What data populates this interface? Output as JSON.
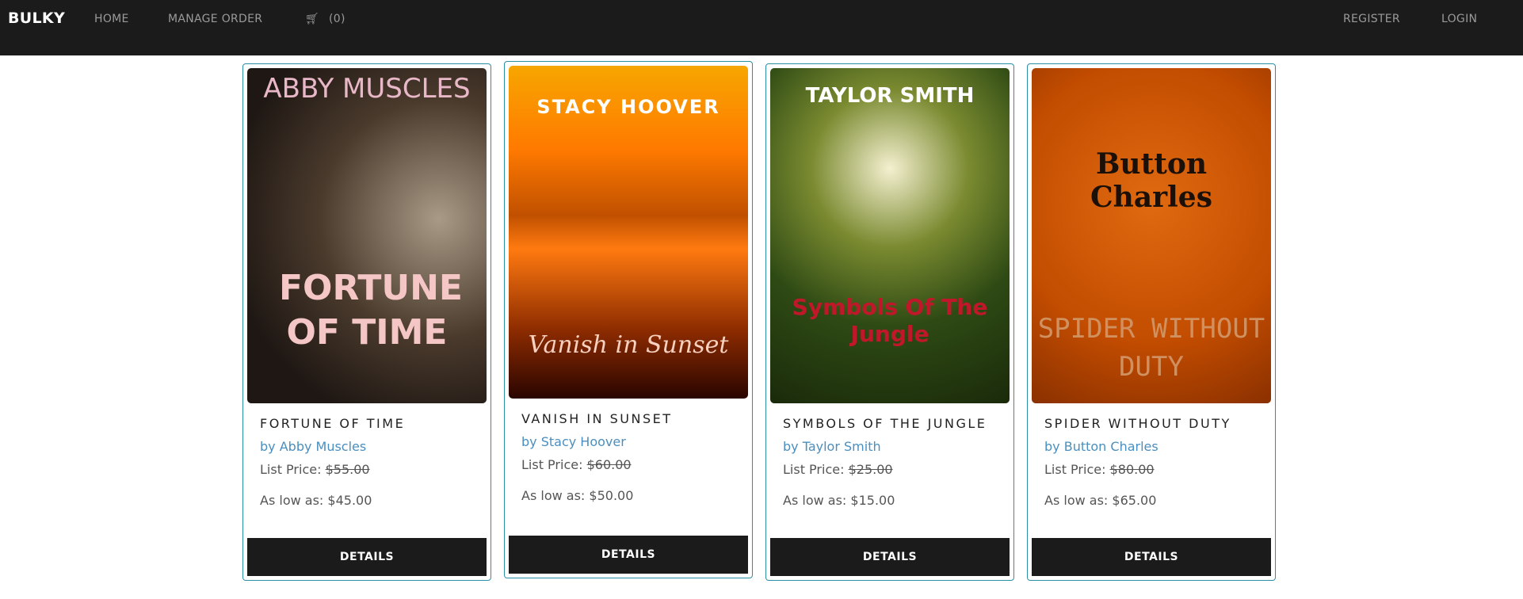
{
  "nav": {
    "brand": "BULKY",
    "home": "HOME",
    "manage": "MANAGE ORDER",
    "cart": "(0)",
    "register": "REGISTER",
    "login": "LOGIN"
  },
  "products": [
    {
      "cover_author": "ABBY MUSCLES",
      "cover_title": "FORTUNE OF TIME",
      "title": "FORTUNE OF TIME",
      "author": "by Abby Muscles",
      "list_label": "List Price:",
      "list_price": "$55.00",
      "low_label": "As low as:",
      "low_price": "$45.00",
      "button": "DETAILS"
    },
    {
      "cover_author": "STACY HOOVER",
      "cover_title": "Vanish in Sunset",
      "title": "VANISH IN SUNSET",
      "author": "by Stacy Hoover",
      "list_label": "List Price:",
      "list_price": "$60.00",
      "low_label": "As low as:",
      "low_price": "$50.00",
      "button": "DETAILS"
    },
    {
      "cover_author": "TAYLOR SMITH",
      "cover_title": "Symbols Of The Jungle",
      "title": "SYMBOLS OF THE JUNGLE",
      "author": "by Taylor Smith",
      "list_label": "List Price:",
      "list_price": "$25.00",
      "low_label": "As low as:",
      "low_price": "$15.00",
      "button": "DETAILS"
    },
    {
      "cover_author": "Button Charles",
      "cover_title": "SPIDER WITHOUT DUTY",
      "title": "SPIDER WITHOUT DUTY",
      "author": "by Button Charles",
      "list_label": "List Price:",
      "list_price": "$80.00",
      "low_label": "As low as:",
      "low_price": "$65.00",
      "button": "DETAILS"
    }
  ]
}
